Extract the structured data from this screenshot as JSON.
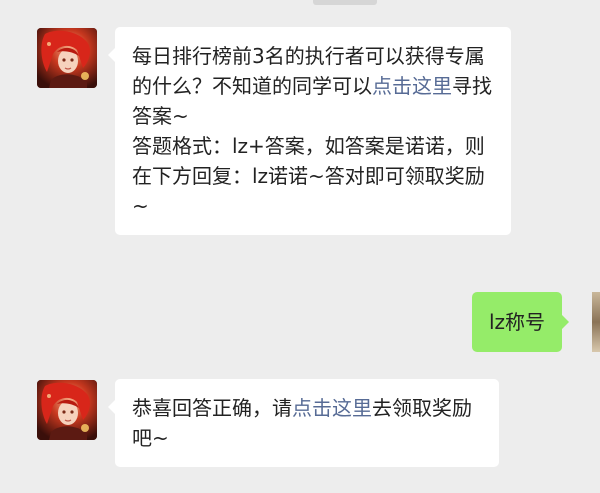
{
  "messages": [
    {
      "side": "left",
      "parts": {
        "p1": "每日排行榜前3名的执行者可以获得专属的什么？不知道的同学可以",
        "link": "点击这里",
        "p2": "寻找答案~",
        "p3": "答题格式：lz+答案，如答案是诺诺，则在下方回复：lz诺诺~答对即可领取奖励~"
      }
    },
    {
      "side": "right",
      "text": "lz称号"
    },
    {
      "side": "left",
      "parts": {
        "p1": "恭喜回答正确，请",
        "link": "点击这里",
        "p2": "去领取奖励吧~"
      }
    }
  ],
  "colors": {
    "background": "#ededed",
    "incoming_bubble": "#ffffff",
    "outgoing_bubble": "#95ec69",
    "link": "#576b95"
  },
  "icons": {
    "contact_avatar": "anime-character-avatar",
    "self_avatar": "user-avatar"
  }
}
